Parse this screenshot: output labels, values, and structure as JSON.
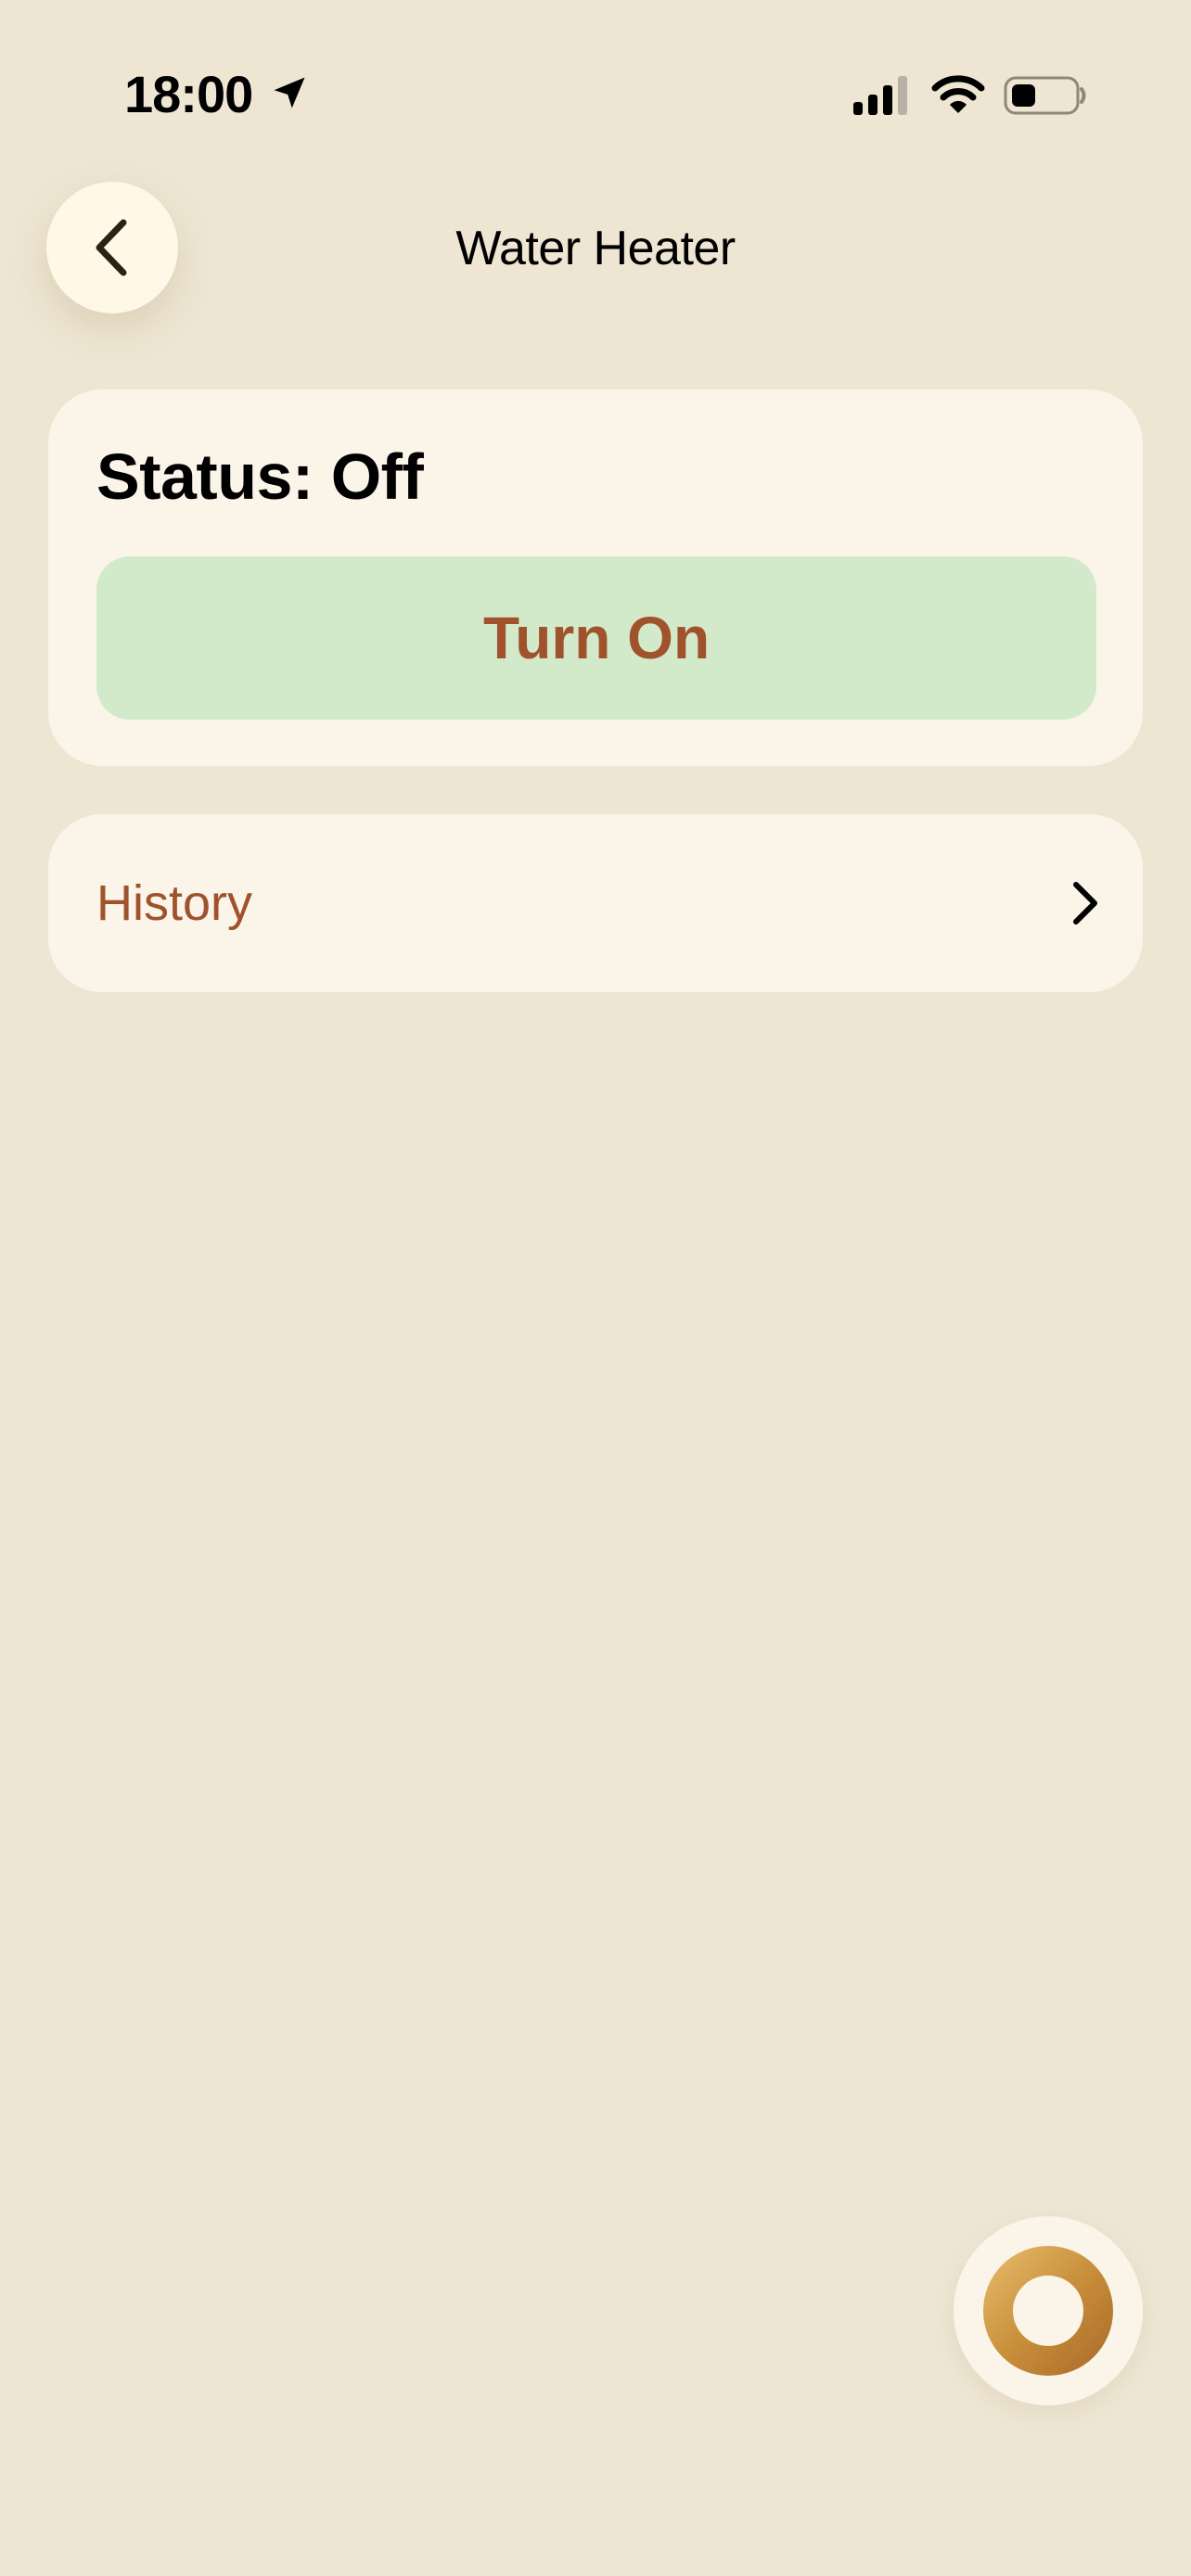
{
  "status_bar": {
    "time": "18:00",
    "icons": [
      "location-arrow-icon",
      "cellular-signal-icon",
      "wifi-icon",
      "battery-icon"
    ]
  },
  "header": {
    "title": "Water Heater",
    "back_icon": "chevron-left-icon"
  },
  "status_card": {
    "status_text": "Status: Off",
    "toggle_label": "Turn On"
  },
  "history": {
    "label": "History",
    "icon": "chevron-right-icon"
  },
  "fab": {
    "icon": "assistant-ring-icon"
  },
  "colors": {
    "background": "#EEE6D3",
    "card": "#FAF4E9",
    "accent_text": "#A0522D",
    "turn_on_button": "#D3EACA",
    "back_button": "#FFF8E6",
    "fab_gradient_start": "#E8BE70",
    "fab_gradient_end": "#A7692A"
  }
}
